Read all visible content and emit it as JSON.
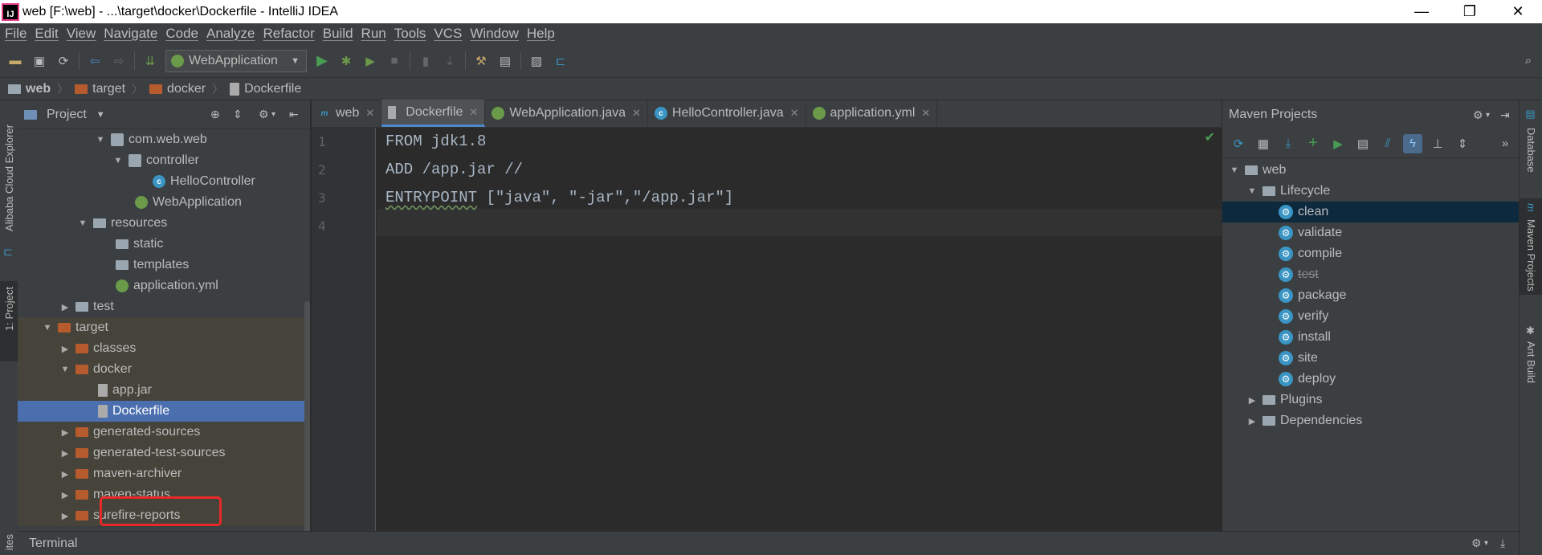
{
  "window": {
    "title": "web [F:\\web] - ...\\target\\docker\\Dockerfile - IntelliJ IDEA",
    "app_icon_label": "IJ",
    "minimize": "—",
    "maximize": "❐",
    "close": "✕"
  },
  "menu": [
    "File",
    "Edit",
    "View",
    "Navigate",
    "Code",
    "Analyze",
    "Refactor",
    "Build",
    "Run",
    "Tools",
    "VCS",
    "Window",
    "Help"
  ],
  "toolbar": {
    "run_config": "WebApplication"
  },
  "breadcrumb": [
    "web",
    "target",
    "docker",
    "Dockerfile"
  ],
  "left_stripe": {
    "alibaba": "Alibaba Cloud Explorer",
    "project": "1: Project",
    "favorites": "ites"
  },
  "project_panel": {
    "title": "Project",
    "tree": [
      {
        "label": "com.web.web",
        "icon": "package-icon",
        "arrow": "▼"
      },
      {
        "label": "controller",
        "icon": "package-icon",
        "arrow": "▼"
      },
      {
        "label": "HelloController",
        "icon": "class-icon",
        "arrow": ""
      },
      {
        "label": "WebApplication",
        "icon": "spring-class-icon",
        "arrow": ""
      },
      {
        "label": "resources",
        "icon": "resources-folder-icon",
        "arrow": "▼"
      },
      {
        "label": "static",
        "icon": "folder-icon",
        "arrow": ""
      },
      {
        "label": "templates",
        "icon": "folder-icon",
        "arrow": ""
      },
      {
        "label": "application.yml",
        "icon": "spring-yml-icon",
        "arrow": ""
      },
      {
        "label": "test",
        "icon": "folder-icon",
        "arrow": "▶"
      },
      {
        "label": "target",
        "icon": "excluded-folder-icon",
        "arrow": "▼"
      },
      {
        "label": "classes",
        "icon": "excluded-folder-icon",
        "arrow": "▶"
      },
      {
        "label": "docker",
        "icon": "excluded-folder-icon",
        "arrow": "▼"
      },
      {
        "label": "app.jar",
        "icon": "jar-file-icon",
        "arrow": ""
      },
      {
        "label": "Dockerfile",
        "icon": "text-file-icon",
        "arrow": ""
      },
      {
        "label": "generated-sources",
        "icon": "excluded-folder-icon",
        "arrow": "▶"
      },
      {
        "label": "generated-test-sources",
        "icon": "excluded-folder-icon",
        "arrow": "▶"
      },
      {
        "label": "maven-archiver",
        "icon": "excluded-folder-icon",
        "arrow": "▶"
      },
      {
        "label": "maven-status",
        "icon": "excluded-folder-icon",
        "arrow": "▶"
      },
      {
        "label": "surefire-reports",
        "icon": "excluded-folder-icon",
        "arrow": "▶"
      }
    ]
  },
  "editor": {
    "tabs": [
      {
        "label": "web",
        "icon": "module-icon"
      },
      {
        "label": "Dockerfile",
        "icon": "text-file-icon",
        "active": true
      },
      {
        "label": "WebApplication.java",
        "icon": "spring-class-icon"
      },
      {
        "label": "HelloController.java",
        "icon": "class-icon"
      },
      {
        "label": "application.yml",
        "icon": "spring-yml-icon"
      }
    ],
    "line_numbers": [
      "1",
      "2",
      "3",
      "4"
    ],
    "lines": [
      "FROM jdk1.8",
      "ADD /app.jar //",
      "[\"java\", \"-jar\",\"/app.jar\"]"
    ],
    "line3_keyword": "ENTRYPOINT"
  },
  "maven": {
    "title": "Maven Projects",
    "root": "web",
    "lifecycle": "Lifecycle",
    "goals": [
      "clean",
      "validate",
      "compile",
      "test",
      "package",
      "verify",
      "install",
      "site",
      "deploy"
    ],
    "plugins": "Plugins",
    "dependencies": "Dependencies"
  },
  "right_stripe": {
    "database": "Database",
    "maven": "Maven Projects",
    "ant": "Ant Build"
  },
  "bottom": {
    "terminal": "Terminal"
  },
  "colors": {
    "selection": "#4b6eaf",
    "highlight_box": "#e82929",
    "maven_selection": "#0d293e"
  }
}
